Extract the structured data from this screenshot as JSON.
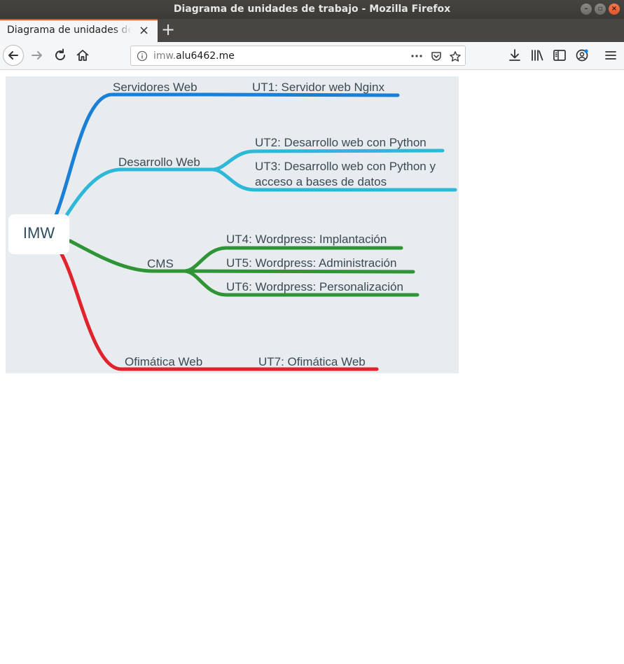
{
  "window": {
    "title": "Diagrama de unidades de trabajo - Mozilla Firefox"
  },
  "tab": {
    "label": "Diagrama de unidades de trabajo",
    "close_glyph": "×",
    "new_tab_glyph": "+"
  },
  "url": {
    "prefix": "imw.",
    "host": "alu6462.me"
  },
  "icons": {
    "back": "back-arrow-icon",
    "forward": "forward-arrow-icon",
    "reload": "reload-icon",
    "home": "home-icon",
    "info": "info-icon",
    "page_actions": "ellipsis-icon",
    "pocket": "pocket-icon",
    "bookmark": "star-icon",
    "downloads": "download-icon",
    "library": "library-icon",
    "sidebar": "sidebar-icon",
    "account": "account-icon",
    "menu": "hamburger-menu-icon"
  },
  "mindmap": {
    "root": "IMW",
    "branches": [
      {
        "label": "Servidores Web",
        "color": "#1a7fd6",
        "children": [
          "UT1: Servidor web Nginx"
        ]
      },
      {
        "label": "Desarrollo Web",
        "color": "#2eb8d8",
        "children": [
          "UT2: Desarrollo web con Python",
          "UT3: Desarrollo web con Python y",
          "acceso a bases de datos"
        ]
      },
      {
        "label": "CMS",
        "color": "#2f9438",
        "children": [
          "UT4: Wordpress: Implantación",
          "UT5: Wordpress: Administración",
          "UT6: Wordpress: Personalización"
        ]
      },
      {
        "label": "Ofimática Web",
        "color": "#e0242e",
        "children": [
          "UT7: Ofimática Web"
        ]
      }
    ]
  },
  "colors": {
    "accent": "#e95420",
    "canvas": "#e8ecef"
  }
}
